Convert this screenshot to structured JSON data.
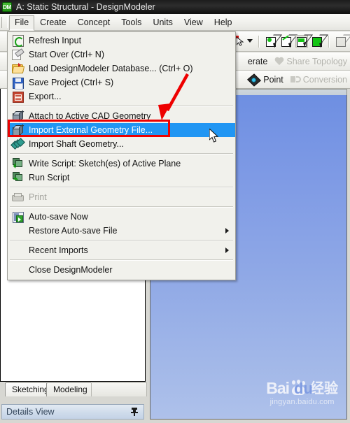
{
  "window": {
    "title": "A: Static Structural - DesignModeler",
    "logo_text": "DM",
    "logo_icon": "designmodeler-logo-icon"
  },
  "menubar": {
    "items": [
      {
        "label": "File",
        "open": true
      },
      {
        "label": "Create",
        "open": false
      },
      {
        "label": "Concept",
        "open": false
      },
      {
        "label": "Tools",
        "open": false
      },
      {
        "label": "Units",
        "open": false
      },
      {
        "label": "View",
        "open": false
      },
      {
        "label": "Help",
        "open": false
      }
    ]
  },
  "toolbar": {
    "selection_filters": [
      {
        "name": "select-mode-cursor",
        "icon": "cursor-dropdown-icon"
      },
      {
        "name": "select-vertices",
        "icon": "vertex-select-icon"
      },
      {
        "name": "select-edges",
        "icon": "edge-select-icon"
      },
      {
        "name": "select-faces",
        "icon": "face-select-icon",
        "pressed": true
      },
      {
        "name": "select-bodies",
        "icon": "body-select-icon"
      },
      {
        "name": "select-extend",
        "icon": "extend-select-icon"
      }
    ],
    "row2": [
      {
        "label": "Generate",
        "icon": "generate-icon",
        "enabled": true,
        "truncated": "erate"
      },
      {
        "label": "Share Topology",
        "icon": "share-topology-icon",
        "enabled": false
      }
    ],
    "row3": [
      {
        "label": "Point",
        "icon": "point-icon",
        "enabled": true
      },
      {
        "label": "Conversion",
        "icon": "conversion-icon",
        "enabled": false
      }
    ]
  },
  "file_menu": {
    "items": [
      {
        "label": "Refresh Input",
        "icon": "refresh-icon",
        "enabled": true,
        "selected": false,
        "submenu": false
      },
      {
        "label": "Start Over (Ctrl+ N)",
        "icon": "start-over-icon",
        "enabled": true,
        "selected": false,
        "submenu": false
      },
      {
        "label": "Load DesignModeler Database... (Ctrl+ O)",
        "icon": "open-folder-icon",
        "enabled": true,
        "selected": false,
        "submenu": false
      },
      {
        "label": "Save Project (Ctrl+ S)",
        "icon": "save-icon",
        "enabled": true,
        "selected": false,
        "submenu": false
      },
      {
        "label": "Export...",
        "icon": "export-icon",
        "enabled": true,
        "selected": false,
        "submenu": false
      },
      {
        "separator": true
      },
      {
        "label": "Attach to Active CAD Geometry",
        "icon": "cad-cube-icon",
        "enabled": true,
        "selected": false,
        "submenu": false
      },
      {
        "label": "Import External Geometry File...",
        "icon": "import-geometry-icon",
        "enabled": true,
        "selected": true,
        "submenu": false
      },
      {
        "label": "Import Shaft Geometry...",
        "icon": "import-shaft-icon",
        "enabled": true,
        "selected": false,
        "submenu": false
      },
      {
        "separator": true
      },
      {
        "label": "Write Script: Sketch(es) of Active Plane",
        "icon": "write-script-icon",
        "enabled": true,
        "selected": false,
        "submenu": false
      },
      {
        "label": "Run Script",
        "icon": "run-script-icon",
        "enabled": true,
        "selected": false,
        "submenu": false
      },
      {
        "separator": true
      },
      {
        "label": "Print",
        "icon": "print-icon",
        "enabled": false,
        "selected": false,
        "submenu": false
      },
      {
        "separator": true
      },
      {
        "label": "Auto-save Now",
        "icon": "auto-save-icon",
        "enabled": true,
        "selected": false,
        "submenu": false
      },
      {
        "label": "Restore Auto-save File",
        "icon": "none",
        "enabled": true,
        "selected": false,
        "submenu": true
      },
      {
        "separator": true
      },
      {
        "label": "Recent Imports",
        "icon": "none",
        "enabled": true,
        "selected": false,
        "submenu": true
      },
      {
        "separator": true
      },
      {
        "label": "Close DesignModeler",
        "icon": "none",
        "enabled": true,
        "selected": false,
        "submenu": false
      }
    ]
  },
  "left_panel": {
    "tabs": [
      {
        "label": "Sketching",
        "active": false
      },
      {
        "label": "Modeling",
        "active": true
      }
    ],
    "details": {
      "label": "Details View",
      "pin_icon": "pin-icon"
    }
  },
  "watermark": {
    "bai": "Bai",
    "du": "du",
    "cn": "经验",
    "url": "jingyan.baidu.com",
    "paw_icon": "baidu-paw-icon"
  },
  "annotations": {
    "highlight_box_color": "#ee0000",
    "arrow_color": "#ee0000",
    "selection_color": "#2196f3",
    "cursor_icon": "mouse-pointer-icon"
  }
}
